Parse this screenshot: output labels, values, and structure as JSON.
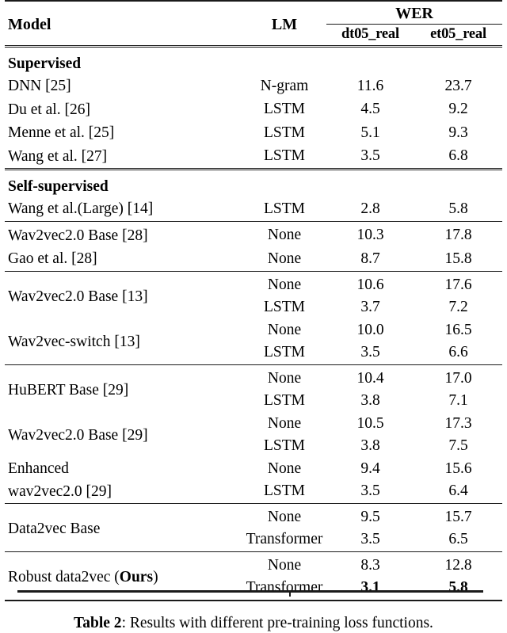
{
  "table": {
    "columns": {
      "model": "Model",
      "lm": "LM",
      "wer_group": "WER",
      "dt05": "dt05_real",
      "et05": "et05_real"
    },
    "sections": [
      {
        "name": "Supervised",
        "rows": [
          {
            "model": "DNN [25]",
            "lm": "N-gram",
            "dt05": "11.6",
            "et05": "23.7"
          },
          {
            "model": "Du et al. [26]",
            "lm": "LSTM",
            "dt05": "4.5",
            "et05": "9.2"
          },
          {
            "model": "Menne et al. [25]",
            "lm": "LSTM",
            "dt05": "5.1",
            "et05": "9.3"
          },
          {
            "model": "Wang et al. [27]",
            "lm": "LSTM",
            "dt05": "3.5",
            "et05": "6.8"
          }
        ]
      },
      {
        "name": "Self-supervised",
        "rows": [
          {
            "model": "Wang et al.(Large) [14]",
            "lm": "LSTM",
            "dt05": "2.8",
            "et05": "5.8"
          }
        ]
      }
    ],
    "groups": [
      {
        "id": "group-wav2vec-28",
        "rows": [
          {
            "model": "Wav2vec2.0 Base [28]",
            "lm": "None",
            "dt05": "10.3",
            "et05": "17.8"
          },
          {
            "model": "Gao et al. [28]",
            "lm": "None",
            "dt05": "8.7",
            "et05": "15.8"
          }
        ]
      },
      {
        "id": "group-wav2vec-13",
        "pairs": [
          {
            "model": "Wav2vec2.0 Base [13]",
            "sub": [
              {
                "lm": "None",
                "dt05": "10.6",
                "et05": "17.6"
              },
              {
                "lm": "LSTM",
                "dt05": "3.7",
                "et05": "7.2"
              }
            ]
          },
          {
            "model": "Wav2vec-switch [13]",
            "sub": [
              {
                "lm": "None",
                "dt05": "10.0",
                "et05": "16.5"
              },
              {
                "lm": "LSTM",
                "dt05": "3.5",
                "et05": "6.6"
              }
            ]
          }
        ]
      },
      {
        "id": "group-hubert-29",
        "pairs": [
          {
            "model": "HuBERT Base [29]",
            "sub": [
              {
                "lm": "None",
                "dt05": "10.4",
                "et05": "17.0"
              },
              {
                "lm": "LSTM",
                "dt05": "3.8",
                "et05": "7.1"
              }
            ]
          },
          {
            "model": "Wav2vec2.0 Base [29]",
            "sub": [
              {
                "lm": "None",
                "dt05": "10.5",
                "et05": "17.3"
              },
              {
                "lm": "LSTM",
                "dt05": "3.8",
                "et05": "7.5"
              }
            ]
          },
          {
            "model_line1": "Enhanced",
            "model_line2": "wav2vec2.0 [29]",
            "sub": [
              {
                "lm": "None",
                "dt05": "9.4",
                "et05": "15.6"
              },
              {
                "lm": "LSTM",
                "dt05": "3.5",
                "et05": "6.4"
              }
            ]
          }
        ]
      },
      {
        "id": "group-data2vec",
        "pairs": [
          {
            "model": "Data2vec Base",
            "sub": [
              {
                "lm": "None",
                "dt05": "9.5",
                "et05": "15.7"
              },
              {
                "lm": "Transformer",
                "dt05": "3.5",
                "et05": "6.5"
              }
            ]
          }
        ]
      },
      {
        "id": "group-robust-data2vec",
        "pairs": [
          {
            "model_prefix": "Robust data2vec (",
            "model_bold": "Ours",
            "model_suffix": ")",
            "sub": [
              {
                "lm": "None",
                "dt05": "8.3",
                "et05": "12.8"
              },
              {
                "lm": "Transformer",
                "dt05": "3.1",
                "et05": "5.8",
                "bold": true
              }
            ]
          }
        ]
      }
    ]
  },
  "caption": {
    "label": "Table 2",
    "text": ": Results with different pre-training loss functions."
  }
}
